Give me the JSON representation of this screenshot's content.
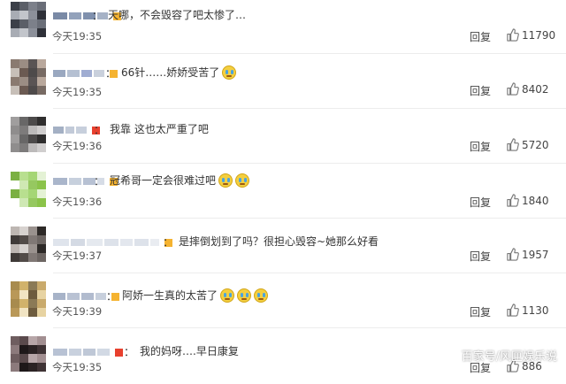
{
  "comments": [
    {
      "text": "天哪，不会毁容了吧太惨了…",
      "emojis": 0,
      "time": "今天19:35",
      "reply": "回复",
      "likes": "11790"
    },
    {
      "text": "66针……娇娇受苦了",
      "emojis": 1,
      "time": "今天19:35",
      "reply": "回复",
      "likes": "8402"
    },
    {
      "text": "我靠 这也太严重了吧",
      "emojis": 0,
      "time": "今天19:36",
      "reply": "回复",
      "likes": "5720"
    },
    {
      "text": "冠希哥一定会很难过吧",
      "emojis": 2,
      "time": "今天19:36",
      "reply": "回复",
      "likes": "1840"
    },
    {
      "text": "是摔倒划到了吗？很担心毁容~她那么好看",
      "emojis": 0,
      "time": "今天19:37",
      "reply": "回复",
      "likes": "1957"
    },
    {
      "text": "阿娇一生真的太苦了",
      "emojis": 3,
      "time": "今天19:39",
      "reply": "回复",
      "likes": "1130"
    },
    {
      "text": "我的妈呀….早日康复",
      "emojis": 0,
      "time": "今天19:35",
      "reply": "回复",
      "likes": "886"
    }
  ],
  "icons": {
    "like": "thumbs-up-icon",
    "emoji": "crying-face-icon"
  },
  "colors": {
    "text": "#333333",
    "meta": "#555555",
    "badge_orange": "#f5b330",
    "badge_red": "#e8402e"
  },
  "watermark": "百家号/风匣娱乐说"
}
